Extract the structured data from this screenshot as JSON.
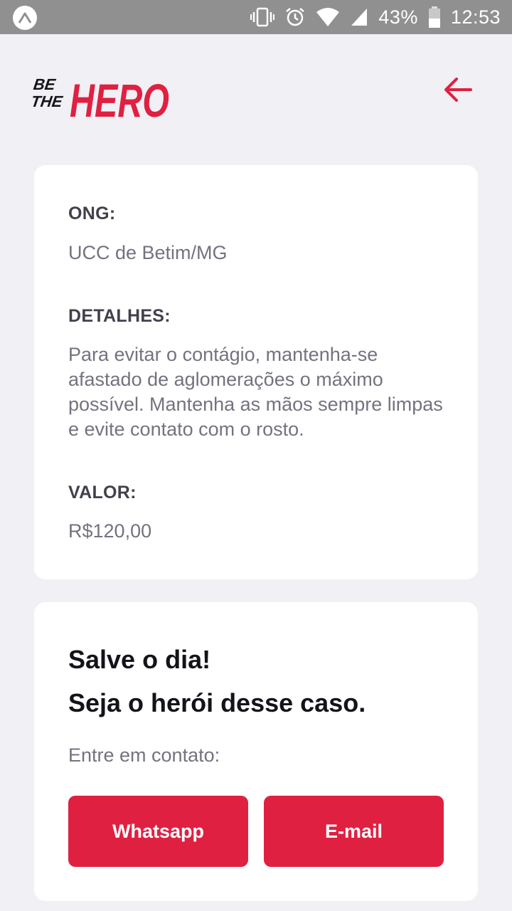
{
  "status_bar": {
    "battery": "43%",
    "time": "12:53",
    "icons": [
      "expo-app-icon",
      "vibrate-icon",
      "alarm-icon",
      "wifi-icon",
      "signal-icon",
      "battery-icon"
    ]
  },
  "header": {
    "logo_text": [
      "BE",
      "THE",
      "HERO"
    ],
    "back_icon": "arrow-left-icon"
  },
  "incident": {
    "ong_label": "ONG:",
    "ong_value": "UCC de Betim/MG",
    "details_label": "DETALHES:",
    "details_value": "Para evitar o contágio, mantenha-se afastado de aglomerações o máximo possível. Mantenha as mãos sempre limpas e evite contato com o rosto.",
    "value_label": "VALOR:",
    "value_value": "R$120,00"
  },
  "contact": {
    "title_line1": "Salve o dia!",
    "title_line2": "Seja o herói desse caso.",
    "prompt": "Entre em contato:",
    "whatsapp_label": "Whatsapp",
    "email_label": "E-mail"
  },
  "colors": {
    "brand_red": "#e02041",
    "background": "#f0f0f5",
    "label": "#41414d",
    "text": "#737380",
    "title": "#13131a"
  }
}
